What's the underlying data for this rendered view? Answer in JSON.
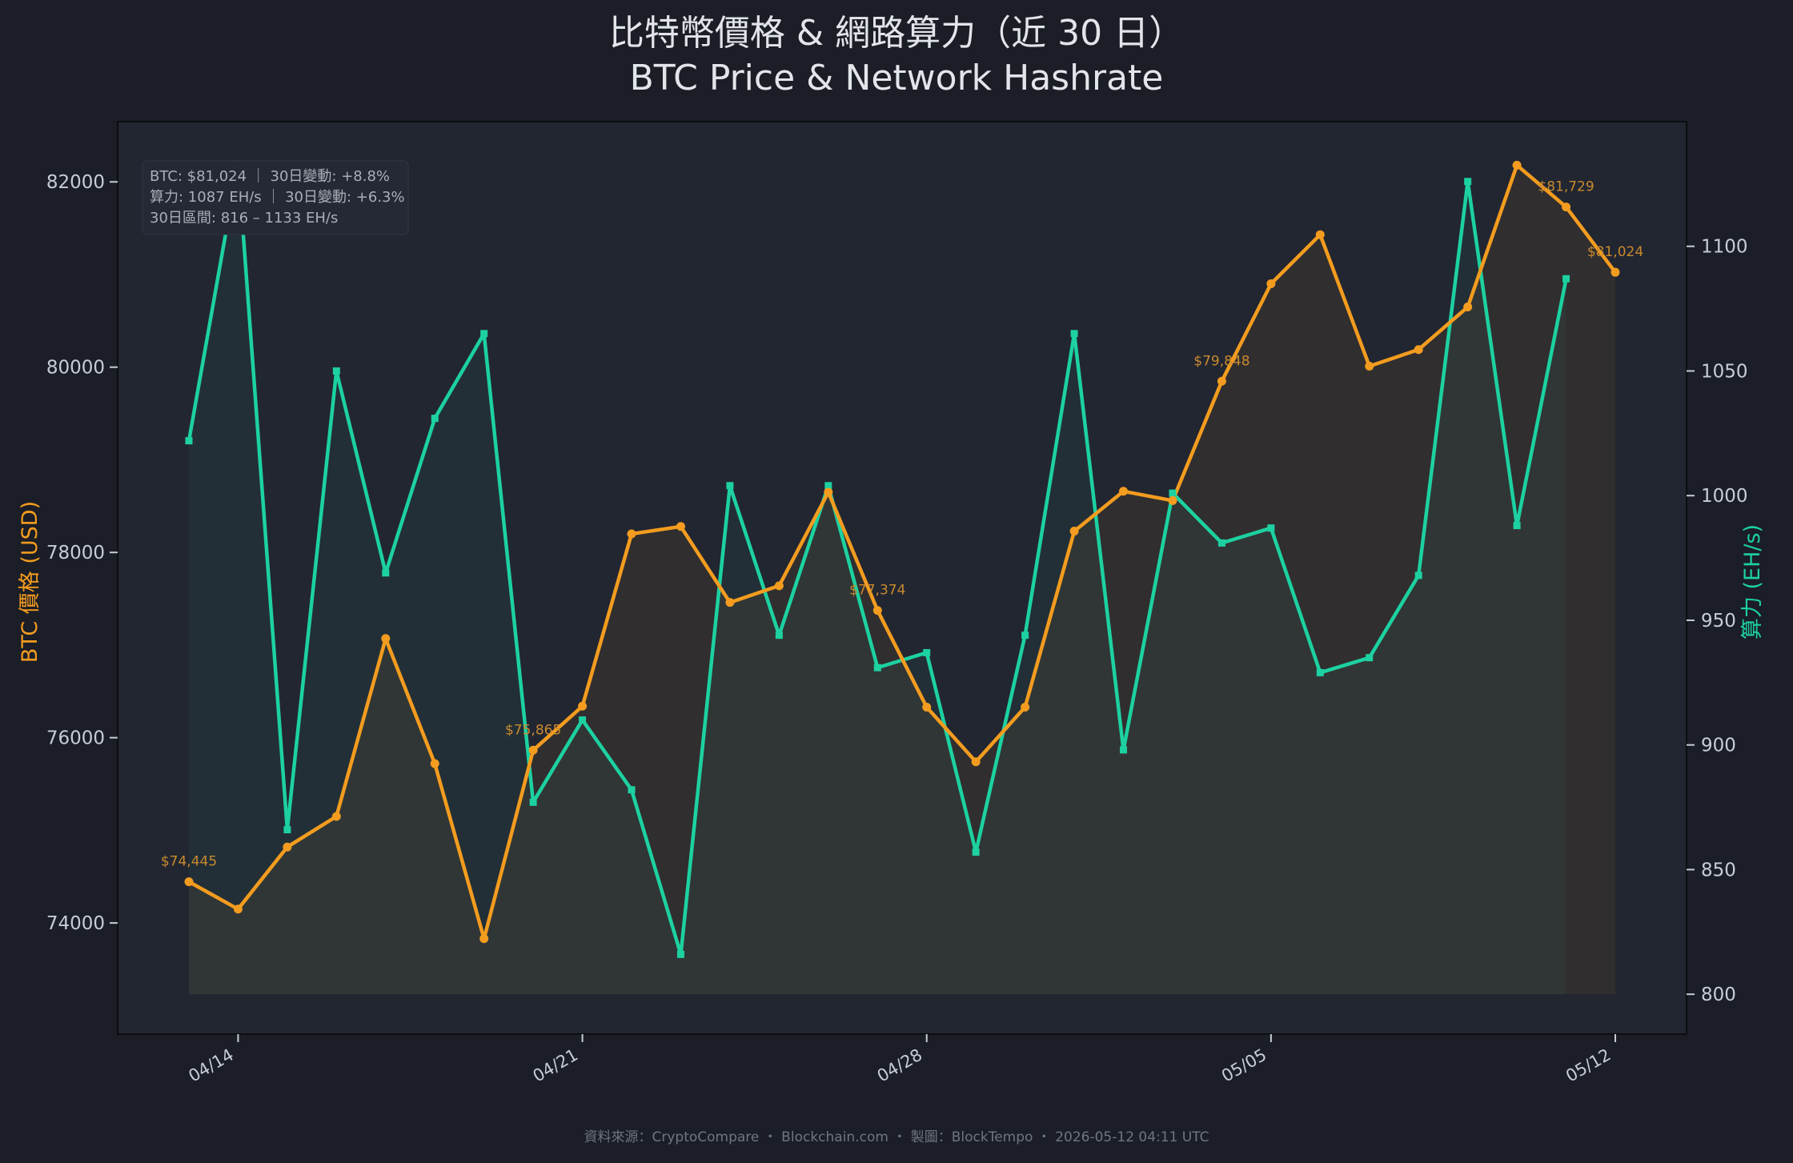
{
  "header": {
    "title_zh": "比特幣價格 & 網路算力（近 30 日）",
    "title_en": "BTC Price & Network Hashrate"
  },
  "info_box": {
    "line1": "BTC: $81,024 ｜ 30日變動: +8.8%",
    "line2": "算力: 1087 EH/s ｜ 30日變動: +6.3%",
    "line3": "30日區間: 816 – 1133 EH/s"
  },
  "footer": {
    "source": "資料來源：CryptoCompare ・ Blockchain.com ・ 製圖：BlockTempo ・ 2026-05-12 04:11 UTC"
  },
  "colors": {
    "background": "#1b1e26",
    "plot_background": "#222631",
    "price": "#f39c1f",
    "hashrate": "#1dd1a1",
    "text": "#c8ccd4",
    "muted_text": "#7a7f89"
  },
  "chart_data": {
    "type": "line",
    "x_labels": [
      "04/14",
      "04/21",
      "04/28",
      "05/05",
      "05/12"
    ],
    "x_label_days": [
      1,
      8,
      15,
      22,
      29
    ],
    "xlim": [
      0,
      29
    ],
    "grid": false,
    "y_left": {
      "label": "BTC 價格 (USD)",
      "ticks": [
        74000,
        76000,
        78000,
        80000,
        82000
      ],
      "ylim": [
        72800,
        82650
      ]
    },
    "y_right": {
      "label": "算力 (EH/s)",
      "ticks": [
        800,
        850,
        900,
        950,
        1000,
        1050,
        1100
      ],
      "ylim": [
        784,
        1150
      ]
    },
    "series": [
      {
        "name": "BTC Price",
        "axis": "left",
        "x": [
          0,
          1,
          2,
          3,
          4,
          5,
          6,
          7,
          8,
          9,
          10,
          11,
          12,
          13,
          14,
          15,
          16,
          17,
          18,
          19,
          20,
          21,
          22,
          23,
          24,
          25,
          26,
          27,
          28,
          29
        ],
        "values": [
          74445,
          74150,
          74820,
          75150,
          77070,
          75720,
          73830,
          75865,
          76340,
          78200,
          78280,
          77460,
          77640,
          78650,
          77374,
          76330,
          75740,
          76330,
          78230,
          78660,
          78560,
          79848,
          80900,
          81430,
          80010,
          80190,
          80650,
          82180,
          81729,
          81024
        ]
      },
      {
        "name": "Hashrate",
        "axis": "right",
        "x": [
          0,
          1,
          2,
          3,
          4,
          5,
          6,
          7,
          8,
          9,
          10,
          11,
          12,
          13,
          14,
          15,
          16,
          17,
          18,
          19,
          20,
          21,
          22,
          23,
          24,
          25,
          26,
          27,
          28
        ],
        "values": [
          1022,
          1133,
          866,
          1050,
          969,
          1031,
          1065,
          877,
          910,
          882,
          816,
          1004,
          944,
          1004,
          931,
          937,
          857,
          944,
          1065,
          898,
          1001,
          981,
          987,
          929,
          935,
          968,
          1126,
          988,
          1087
        ]
      }
    ],
    "annotations": [
      {
        "x": 0,
        "y": 74445,
        "text": "$74,445"
      },
      {
        "x": 7,
        "y": 75865,
        "text": "$75,865"
      },
      {
        "x": 14,
        "y": 77374,
        "text": "$77,374"
      },
      {
        "x": 21,
        "y": 79848,
        "text": "$79,848"
      },
      {
        "x": 28,
        "y": 81729,
        "text": "$81,729"
      },
      {
        "x": 29,
        "y": 81024,
        "text": "$81,024"
      }
    ]
  }
}
